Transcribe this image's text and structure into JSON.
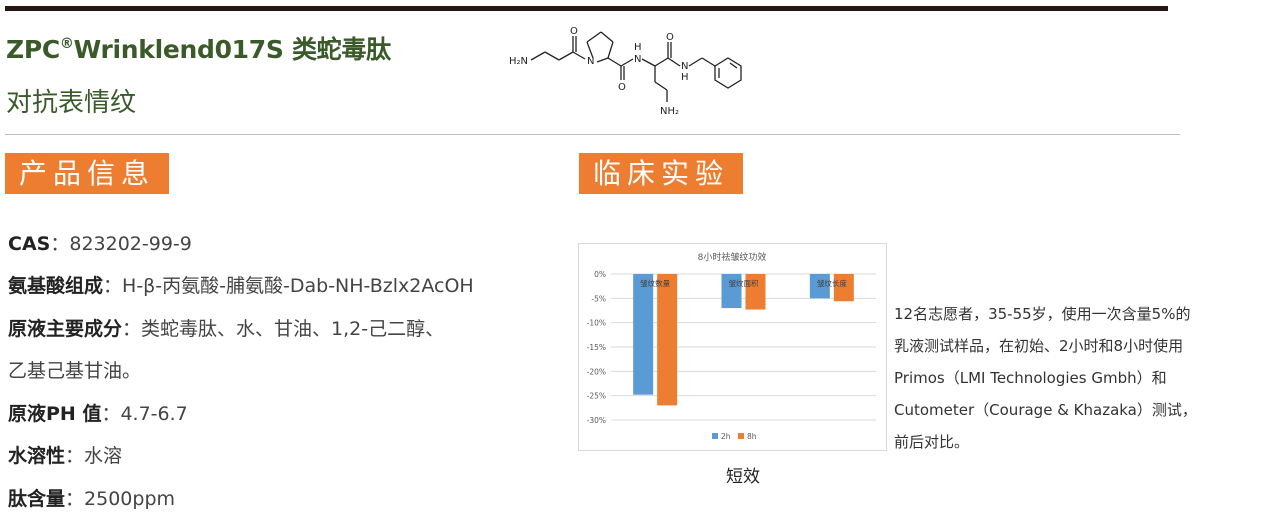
{
  "header": {
    "brand_prefix": "ZPC",
    "brand_mark": "®",
    "brand_rest": "Wrinklend017S 类蛇毒肽",
    "subtitle": "对抗表情纹"
  },
  "molecule": {
    "label_h2n": "H₂N",
    "label_n1": "N",
    "label_h1": "H",
    "label_n2": "N",
    "label_h2": "H",
    "label_nh2": "NH₂",
    "label_o1": "O",
    "label_o2": "O",
    "label_o3": "O"
  },
  "sections": {
    "product_info": "产品信息",
    "clinical": "临床实验"
  },
  "product": {
    "rows": [
      {
        "key": "CAS",
        "sep": "：",
        "value": "823202-99-9"
      },
      {
        "key": "氨基酸组成",
        "sep": "：",
        "value": "H-β-丙氨酸-脯氨酸-Dab-NH-Bzlx2AcOH"
      },
      {
        "key": "原液主要成分",
        "sep": "：",
        "value": "类蛇毒肽、水、甘油、1,2-己二醇、"
      },
      {
        "key": "",
        "sep": "",
        "value": "乙基己基甘油。"
      },
      {
        "key": "原液PH 值",
        "sep": "：",
        "value": "4.7-6.7"
      },
      {
        "key": "水溶性",
        "sep": "：",
        "value": "水溶"
      },
      {
        "key": "肽含量",
        "sep": "：",
        "value": "2500ppm"
      }
    ]
  },
  "chart_data": {
    "type": "bar",
    "title": "8小时祛皱纹功效",
    "categories": [
      "皱纹数量",
      "皱纹面积",
      "皱纹长度"
    ],
    "series": [
      {
        "name": "2h",
        "values": [
          -24.8,
          -7.0,
          -5.0
        ],
        "color": "#5b9bd5"
      },
      {
        "name": "8h",
        "values": [
          -27.0,
          -7.3,
          -5.6
        ],
        "color": "#ed7d31"
      }
    ],
    "ylim": [
      -30,
      0
    ],
    "yticks": [
      "0%",
      "-5%",
      "-10%",
      "-15%",
      "-20%",
      "-25%",
      "-30%"
    ],
    "grid": true,
    "legend": "bottom"
  },
  "clinical": {
    "caption": "短效",
    "description": "12名志愿者，35-55岁，使用一次含量5%的乳液测试样品，在初始、2小时和8小时使用Primos（LMI Technologies Gmbh）和Cutometer（Courage & Khazaka）测试，前后对比。"
  },
  "colors": {
    "accent": "#ed7d31",
    "title_green": "#3a5a2a",
    "series_blue": "#5b9bd5"
  }
}
